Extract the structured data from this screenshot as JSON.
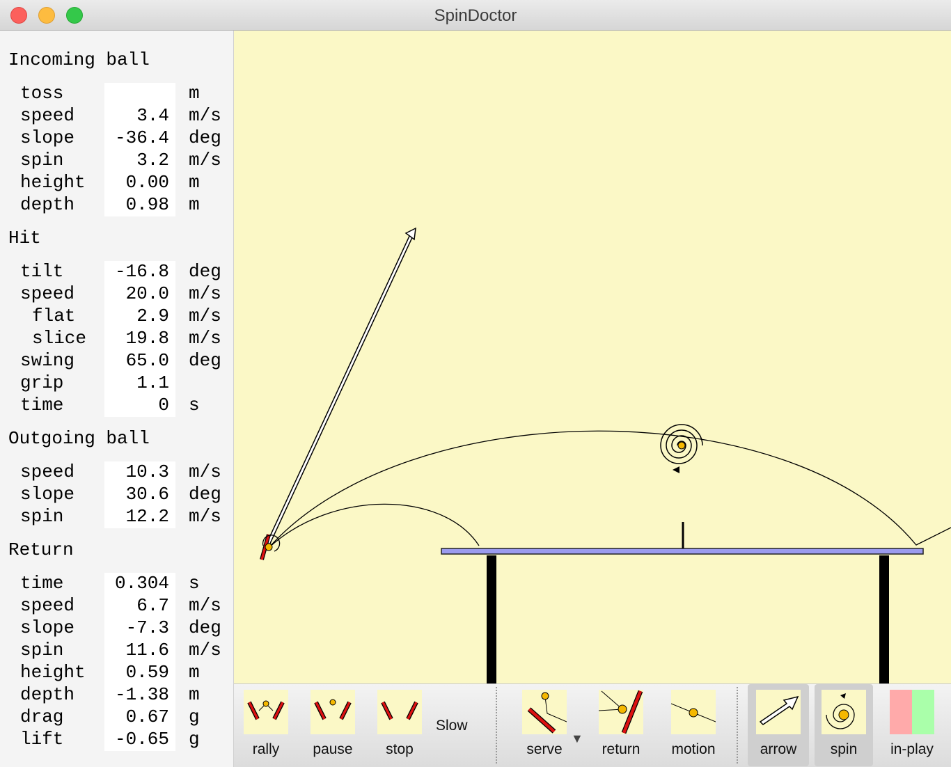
{
  "window": {
    "title": "SpinDoctor"
  },
  "panel": {
    "incoming": {
      "title": "Incoming ball",
      "rows": [
        {
          "label": "toss",
          "value": "",
          "unit": "m"
        },
        {
          "label": "speed",
          "value": "3.4",
          "unit": "m/s"
        },
        {
          "label": "slope",
          "value": "-36.4",
          "unit": "deg"
        },
        {
          "label": "spin",
          "value": "3.2",
          "unit": "m/s"
        },
        {
          "label": "height",
          "value": "0.00",
          "unit": "m"
        },
        {
          "label": "depth",
          "value": "0.98",
          "unit": "m"
        }
      ]
    },
    "hit": {
      "title": "Hit",
      "rows": [
        {
          "label": "tilt",
          "value": "-16.8",
          "unit": "deg"
        },
        {
          "label": "speed",
          "value": "20.0",
          "unit": "m/s"
        },
        {
          "label": "flat",
          "value": "2.9",
          "unit": "m/s"
        },
        {
          "label": "slice",
          "value": "19.8",
          "unit": "m/s"
        },
        {
          "label": "swing",
          "value": "65.0",
          "unit": "deg"
        },
        {
          "label": "grip",
          "value": "1.1",
          "unit": ""
        },
        {
          "label": "time",
          "value": "0",
          "unit": "s"
        }
      ]
    },
    "outgoing": {
      "title": "Outgoing ball",
      "rows": [
        {
          "label": "speed",
          "value": "10.3",
          "unit": "m/s"
        },
        {
          "label": "slope",
          "value": "30.6",
          "unit": "deg"
        },
        {
          "label": "spin",
          "value": "12.2",
          "unit": "m/s"
        }
      ]
    },
    "return": {
      "title": "Return",
      "rows": [
        {
          "label": "time",
          "value": "0.304",
          "unit": "s"
        },
        {
          "label": "speed",
          "value": "6.7",
          "unit": "m/s"
        },
        {
          "label": "slope",
          "value": "-7.3",
          "unit": "deg"
        },
        {
          "label": "spin",
          "value": "11.6",
          "unit": "m/s"
        },
        {
          "label": "height",
          "value": "0.59",
          "unit": "m"
        },
        {
          "label": "depth",
          "value": "-1.38",
          "unit": "m"
        },
        {
          "label": "drag",
          "value": "0.67",
          "unit": "g"
        },
        {
          "label": "lift",
          "value": "-0.65",
          "unit": "g"
        }
      ]
    }
  },
  "toolbar": {
    "rally": "rally",
    "pause": "pause",
    "stop": "stop",
    "speed_mode": "Slow",
    "serve": "serve",
    "return": "return",
    "motion": "motion",
    "arrow": "arrow",
    "spin": "spin",
    "in_play": "in-play"
  },
  "colors": {
    "canvas_bg": "#fbf8c6",
    "table_top": "#9b9bee",
    "ball": "#f5b800",
    "paddle": "#dd1111",
    "in_play_red": "#ffaaaa",
    "in_play_green": "#aaffaa"
  }
}
